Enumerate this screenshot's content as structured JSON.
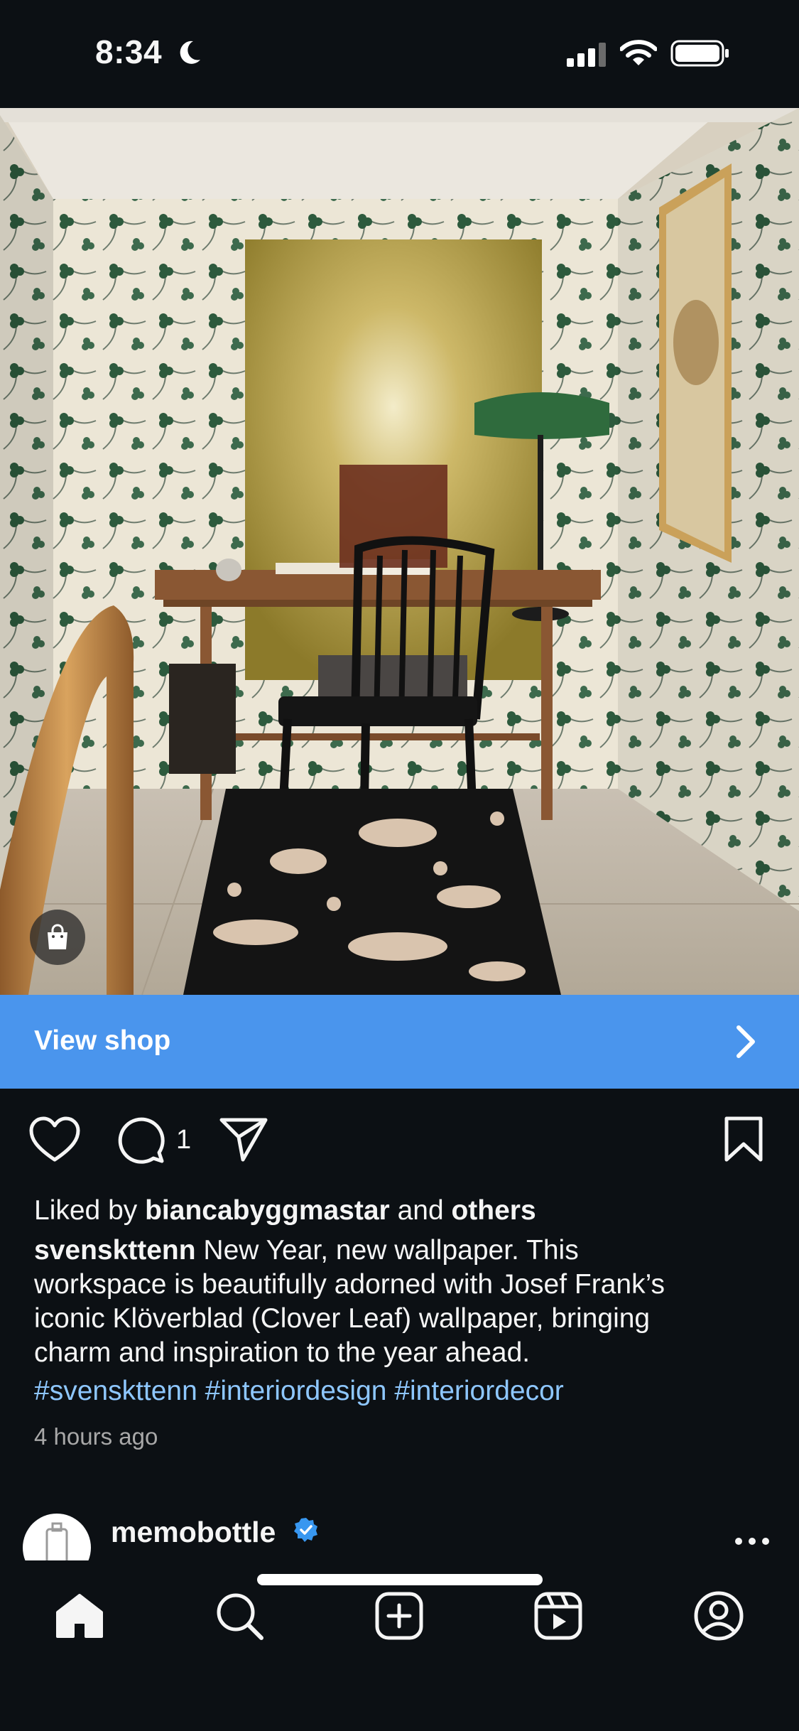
{
  "status_bar": {
    "time": "8:34"
  },
  "post": {
    "view_shop_label": "View shop",
    "comment_count": "1",
    "liked_by": {
      "prefix": "Liked by ",
      "user": "biancabyggmastar",
      "middle": " and ",
      "others": "others"
    },
    "caption": {
      "username": "svenskttenn",
      "line1": " New Year, new wallpaper. This",
      "line2": "workspace is beautifully adorned with Josef Frank’s",
      "line3": "iconic Klöverblad (Clover Leaf) wallpaper, bringing",
      "line4": "charm and inspiration to the year ahead."
    },
    "hashtags": [
      "#svenskttenn",
      "#interiordesign",
      "#interiordecor"
    ],
    "timestamp": "4 hours ago"
  },
  "next_post": {
    "username": "memobottle",
    "verified": true
  },
  "tab_bar": {
    "items": [
      "home-icon",
      "search-icon",
      "create-icon",
      "reels-icon",
      "profile-icon"
    ],
    "active": "home-icon"
  },
  "colors": {
    "background": "#0c1014",
    "view_shop_bar": "#4a95ed",
    "hashtag": "#8ec7ff",
    "verified": "#3897f0",
    "muted_text": "#a8a8a8"
  }
}
